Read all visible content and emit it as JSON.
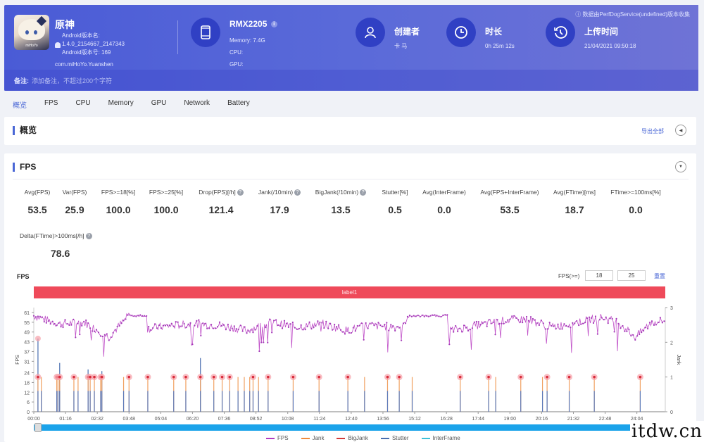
{
  "header": {
    "app": {
      "name": "原神",
      "icon_label": "miHoYo",
      "android_version_name_label": "Android版本名:",
      "android_version_name": "1.4.0_2154667_2147343",
      "android_version_code_label": "Android版本号:",
      "android_version_code": "169",
      "package": "com.miHoYo.Yuanshen"
    },
    "device": {
      "model": "RMX2205",
      "memory": "Memory: 7.4G",
      "cpu": "CPU:",
      "gpu": "GPU:"
    },
    "creator": {
      "title": "创建者",
      "value": "卡 马"
    },
    "duration": {
      "title": "时长",
      "value": "0h 25m 12s"
    },
    "upload": {
      "title": "上传时间",
      "value": "21/04/2021 09:50:18"
    },
    "collector_note": "数据由PerfDogService(undefined)版本收集",
    "notes_label": "备注:",
    "notes_placeholder": "添加备注，不超过200个字符"
  },
  "tabs": [
    {
      "label": "概览",
      "active": true
    },
    {
      "label": "FPS",
      "active": false
    },
    {
      "label": "CPU",
      "active": false
    },
    {
      "label": "Memory",
      "active": false
    },
    {
      "label": "GPU",
      "active": false
    },
    {
      "label": "Network",
      "active": false
    },
    {
      "label": "Battery",
      "active": false
    }
  ],
  "overview": {
    "title": "概览",
    "export_label": "导出全部"
  },
  "fps_section": {
    "title": "FPS",
    "metrics": [
      {
        "label": "Avg(FPS)",
        "value": "53.5",
        "help": false
      },
      {
        "label": "Var(FPS)",
        "value": "25.9",
        "help": false
      },
      {
        "label": "FPS>=18[%]",
        "value": "100.0",
        "help": false
      },
      {
        "label": "FPS>=25[%]",
        "value": "100.0",
        "help": false
      },
      {
        "label": "Drop(FPS)[/h]",
        "value": "121.4",
        "help": true
      },
      {
        "label": "Jank(/10min)",
        "value": "17.9",
        "help": true
      },
      {
        "label": "BigJank(/10min)",
        "value": "13.5",
        "help": true
      },
      {
        "label": "Stutter[%]",
        "value": "0.5",
        "help": false
      },
      {
        "label": "Avg(InterFrame)",
        "value": "0.0",
        "help": false
      },
      {
        "label": "Avg(FPS+InterFrame)",
        "value": "53.5",
        "help": false
      },
      {
        "label": "Avg(FTime)[ms]",
        "value": "18.7",
        "help": false
      },
      {
        "label": "FTime>=100ms[%]",
        "value": "0.0",
        "help": false
      },
      {
        "label": "Delta(FTime)>100ms[/h]",
        "value": "78.6",
        "help": true
      }
    ],
    "chart_title": "FPS",
    "threshold_label": "FPS(>=)",
    "threshold_low": "18",
    "threshold_high": "25",
    "reset_label": "重置",
    "label_bar": "label1"
  },
  "chart_data": {
    "type": "line",
    "title": "FPS",
    "xlabel": "",
    "ylabel": "FPS",
    "y2label": "Jank",
    "x_ticks": [
      "00:00",
      "01:16",
      "02:32",
      "03:48",
      "05:04",
      "06:20",
      "07:36",
      "08:52",
      "10:08",
      "11:24",
      "12:40",
      "13:56",
      "15:12",
      "16:28",
      "17:44",
      "19:00",
      "20:16",
      "21:32",
      "22:48",
      "24:04"
    ],
    "y_ticks": [
      0,
      6,
      12,
      18,
      24,
      31,
      37,
      43,
      49,
      55,
      61
    ],
    "y2_ticks": [
      0,
      1,
      2,
      3
    ],
    "ylim": [
      0,
      61
    ],
    "y2lim": [
      0,
      3
    ],
    "duration_seconds": 1512,
    "legend": [
      {
        "name": "FPS",
        "color": "#b23cc0"
      },
      {
        "name": "Jank",
        "color": "#f08a3c"
      },
      {
        "name": "BigJank",
        "color": "#d23a3a"
      },
      {
        "name": "Stutter",
        "color": "#4a6fb0"
      },
      {
        "name": "InterFrame",
        "color": "#3cc0d8"
      }
    ],
    "legend_position": "bottom",
    "fps_profile": [
      {
        "t": 0,
        "fps": 59
      },
      {
        "t": 60,
        "fps": 54
      },
      {
        "t": 120,
        "fps": 55
      },
      {
        "t": 180,
        "fps": 46
      },
      {
        "t": 230,
        "fps": 60
      },
      {
        "t": 270,
        "fps": 51
      },
      {
        "t": 330,
        "fps": 53
      },
      {
        "t": 390,
        "fps": 54
      },
      {
        "t": 450,
        "fps": 53
      },
      {
        "t": 510,
        "fps": 50
      },
      {
        "t": 570,
        "fps": 55
      },
      {
        "t": 630,
        "fps": 52
      },
      {
        "t": 690,
        "fps": 54
      },
      {
        "t": 750,
        "fps": 50
      },
      {
        "t": 800,
        "fps": 53
      },
      {
        "t": 870,
        "fps": 52
      },
      {
        "t": 910,
        "fps": 59
      },
      {
        "t": 960,
        "fps": 59
      },
      {
        "t": 1000,
        "fps": 50
      },
      {
        "t": 1060,
        "fps": 53
      },
      {
        "t": 1120,
        "fps": 56
      },
      {
        "t": 1180,
        "fps": 57
      },
      {
        "t": 1240,
        "fps": 52
      },
      {
        "t": 1300,
        "fps": 55
      },
      {
        "t": 1360,
        "fps": 58
      },
      {
        "t": 1400,
        "fps": 55
      },
      {
        "t": 1440,
        "fps": 46
      },
      {
        "t": 1480,
        "fps": 55
      },
      {
        "t": 1512,
        "fps": 56
      }
    ],
    "jank_events_seconds": [
      10,
      18,
      55,
      58,
      62,
      96,
      106,
      130,
      135,
      145,
      160,
      163,
      215,
      228,
      273,
      335,
      364,
      399,
      431,
      451,
      469,
      489,
      504,
      517,
      525,
      538,
      561,
      621,
      683,
      752,
      792,
      847,
      875,
      906,
      1021,
      1089,
      1106,
      1166,
      1218,
      1229,
      1282,
      1342,
      1452
    ],
    "bigjank_events_seconds": [
      10,
      55,
      58,
      62,
      96,
      130,
      135,
      145,
      160,
      163,
      228,
      273,
      335,
      364,
      399,
      431,
      451,
      469,
      525,
      561,
      621,
      683,
      752,
      847,
      875,
      1021,
      1089,
      1166,
      1229,
      1282,
      1342,
      1452
    ],
    "stutter_spikes": [
      {
        "t": 10,
        "fps": 45
      },
      {
        "t": 62,
        "fps": 30
      },
      {
        "t": 130,
        "fps": 26
      },
      {
        "t": 163,
        "fps": 25
      },
      {
        "t": 399,
        "fps": 33
      }
    ]
  }
}
